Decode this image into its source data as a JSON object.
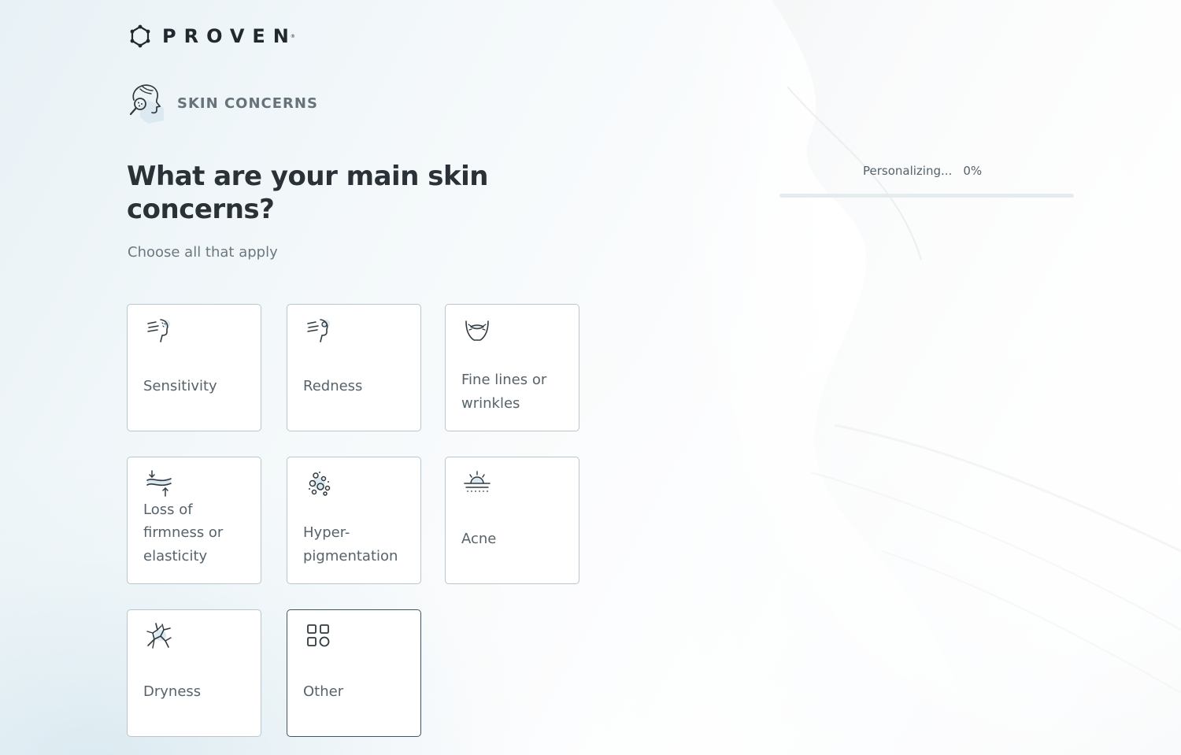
{
  "brand": {
    "name": "PROVEN",
    "registered": "®"
  },
  "section": {
    "title": "SKIN CONCERNS",
    "icon": "face-magnifier-icon"
  },
  "question": {
    "title": "What are your main skin concerns?",
    "hint": "Choose all that apply"
  },
  "options": [
    {
      "label": "Sensitivity",
      "icon": "sensitivity-icon",
      "selected": false
    },
    {
      "label": "Redness",
      "icon": "redness-icon",
      "selected": false
    },
    {
      "label": "Fine lines or wrinkles",
      "icon": "fine-lines-icon",
      "selected": false
    },
    {
      "label": "Loss of firmness or elasticity",
      "icon": "firmness-icon",
      "selected": false
    },
    {
      "label": "Hyper-pigmentation",
      "icon": "hyperpigmentation-icon",
      "selected": false
    },
    {
      "label": "Acne",
      "icon": "acne-icon",
      "selected": false
    },
    {
      "label": "Dryness",
      "icon": "dryness-icon",
      "selected": false
    },
    {
      "label": "Other",
      "icon": "other-grid-icon",
      "selected": false
    }
  ],
  "progress": {
    "label": "Personalizing...",
    "percent_text": "0%",
    "value": 0
  },
  "colors": {
    "text_dark": "#2a3237",
    "text_muted": "#6b7880",
    "card_border": "#b9c6cd",
    "accent": "#3e5863"
  }
}
